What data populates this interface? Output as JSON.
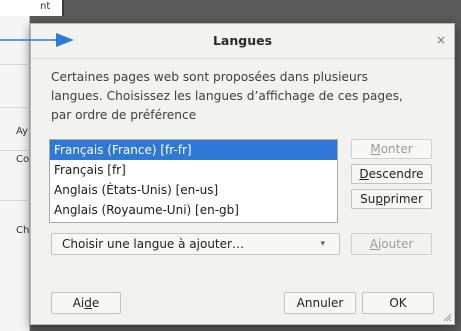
{
  "background": {
    "fragments": [
      "nt",
      "Ay",
      "Cou",
      "Ch"
    ]
  },
  "dialog": {
    "title": "Langues",
    "close_glyph": "×",
    "description": "Certaines pages web sont proposées dans plusieurs langues. Choisissez les langues d’affichage de ces pages, par ordre de préférence",
    "languages": [
      {
        "label": "Français (France) [fr-fr]",
        "selected": true
      },
      {
        "label": "Français [fr]",
        "selected": false
      },
      {
        "label": "Anglais (États-Unis) [en-us]",
        "selected": false
      },
      {
        "label": "Anglais (Royaume-Uni) [en-gb]",
        "selected": false
      }
    ],
    "buttons": {
      "move_up": "Monter",
      "move_down": "Descendre",
      "remove": "Supprimer",
      "add": "Ajouter",
      "help": "Aide",
      "cancel": "Annuler",
      "ok": "OK"
    },
    "dropdown": {
      "value": "Choisir une langue à ajouter…"
    }
  },
  "colors": {
    "selection": "#2f78d6",
    "arrow": "#2f78d6",
    "disabled_text": "#9c9c9c"
  }
}
